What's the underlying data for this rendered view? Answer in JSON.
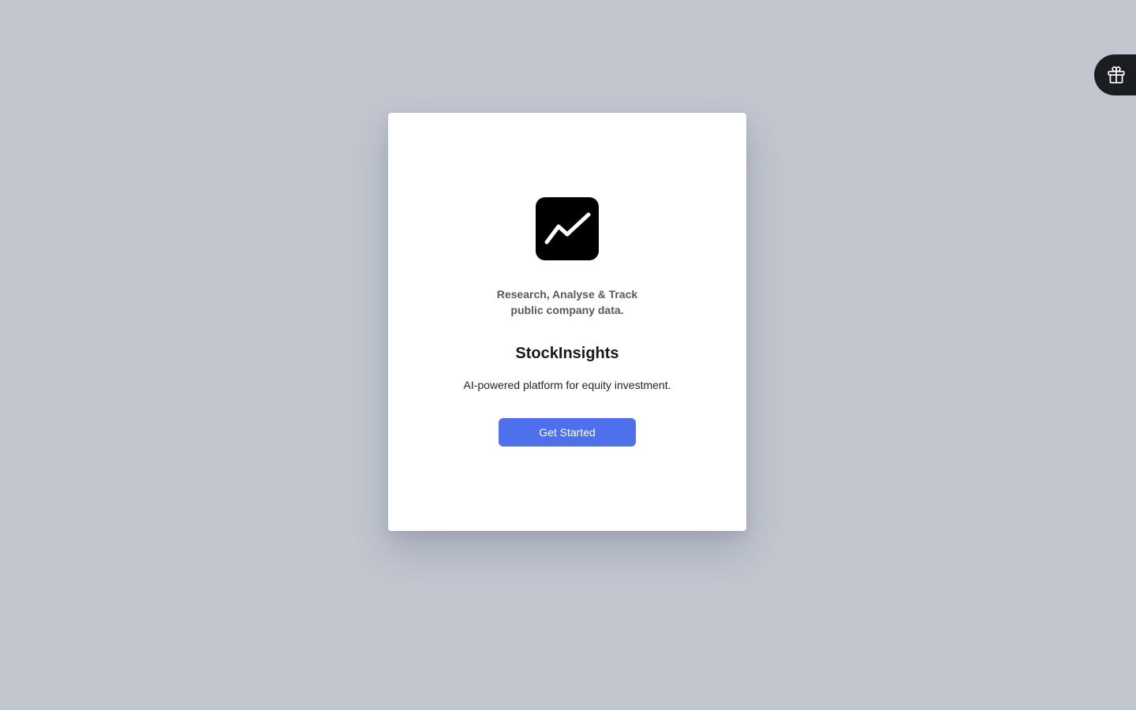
{
  "welcome_card": {
    "logo_icon": "trending-line-icon",
    "tagline_line1": "Research, Analyse & Track",
    "tagline_line2": "public company data.",
    "brand_name": "StockInsights",
    "description": "AI-powered platform for equity investment.",
    "cta_label": "Get Started"
  },
  "floating_tab": {
    "icon": "gift-icon"
  },
  "colors": {
    "background": "#c1c6cf",
    "card": "#ffffff",
    "logo_bg": "#000000",
    "cta_bg": "#4f70ec",
    "tab_bg": "#1c1d21"
  }
}
